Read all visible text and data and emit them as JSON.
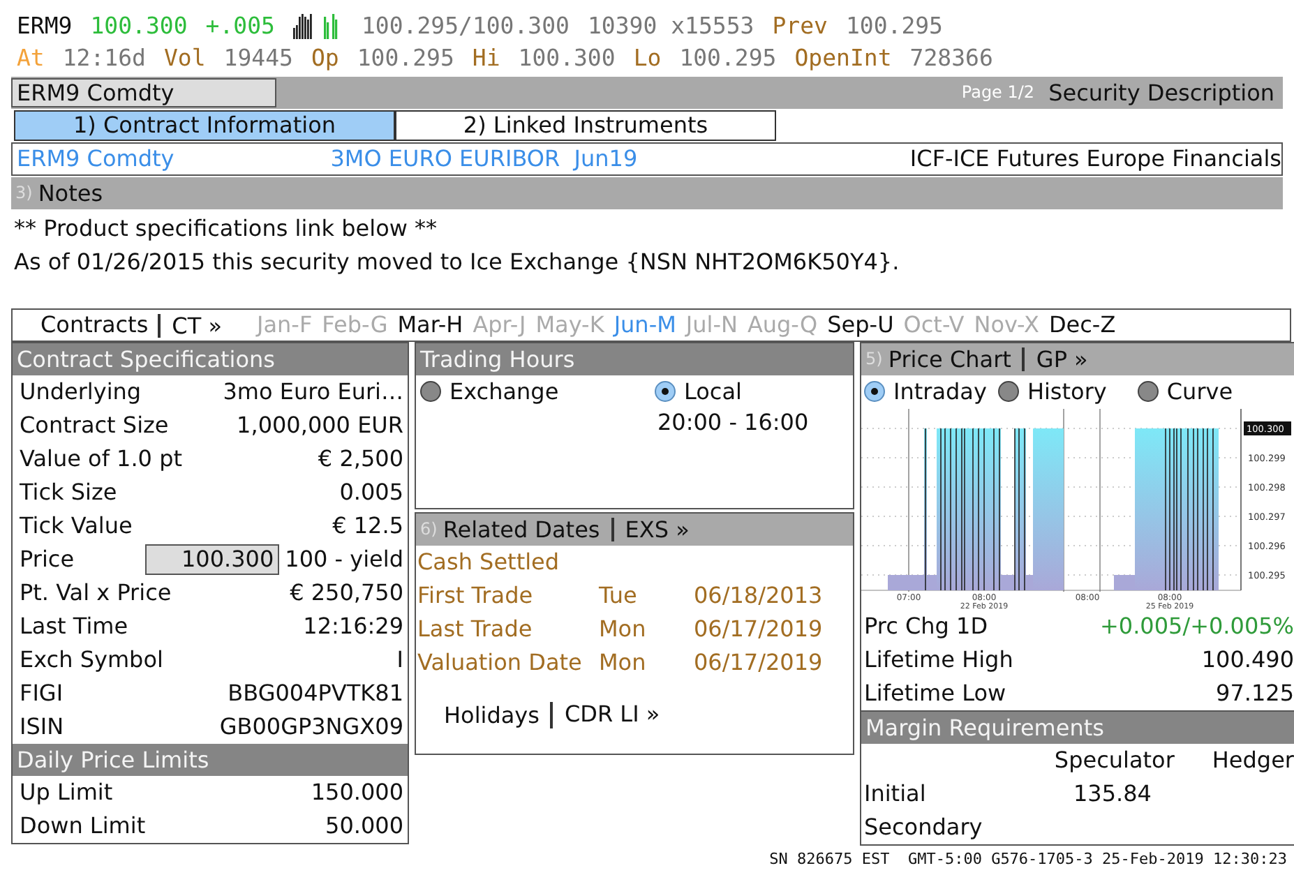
{
  "quote": {
    "lines": [
      [
        {
          "kind": "ticker",
          "text": "ERM9"
        },
        {
          "kind": "up",
          "text": "100.300"
        },
        {
          "kind": "up",
          "text": "+.005"
        },
        {
          "kind": "spark"
        },
        {
          "kind": "value",
          "text": "100.295/100.300"
        },
        {
          "kind": "value",
          "text": "10390 x15553"
        },
        {
          "kind": "label",
          "text": "Prev"
        },
        {
          "kind": "value",
          "text": "100.295"
        }
      ],
      [
        {
          "kind": "time",
          "text": "At"
        },
        {
          "kind": "value",
          "text": "12:16d"
        },
        {
          "kind": "label",
          "text": "Vol"
        },
        {
          "kind": "value",
          "text": "19445"
        },
        {
          "kind": "label",
          "text": "Op"
        },
        {
          "kind": "value",
          "text": "100.295"
        },
        {
          "kind": "label",
          "text": "Hi"
        },
        {
          "kind": "value",
          "text": "100.300"
        },
        {
          "kind": "label",
          "text": "Lo"
        },
        {
          "kind": "value",
          "text": "100.295"
        },
        {
          "kind": "label",
          "text": "OpenInt"
        },
        {
          "kind": "value",
          "text": "728366"
        }
      ]
    ]
  },
  "title_bar": {
    "security": "ERM9 Comdty",
    "page": "Page 1/2",
    "title": "Security Description"
  },
  "tabs": [
    {
      "label": "1) Contract Information",
      "selected": true
    },
    {
      "label": "2) Linked Instruments",
      "selected": false
    }
  ],
  "info_line": {
    "ticker": "ERM9 Comdty",
    "name": "3MO EURO EURIBOR  Jun19",
    "exchange": "ICF-ICE Futures Europe Financials"
  },
  "notes": {
    "number": "3)",
    "title": "Notes",
    "lines": [
      "** Product specifications link below **",
      "As of 01/26/2015 this security moved to Ice Exchange {NSN NHT2OM6K50Y4}."
    ]
  },
  "contracts": {
    "title": "Contracts",
    "link": "CT »",
    "months": [
      {
        "label": "Jan-F",
        "active": false,
        "selected": false
      },
      {
        "label": "Feb-G",
        "active": false,
        "selected": false
      },
      {
        "label": "Mar-H",
        "active": true,
        "selected": false
      },
      {
        "label": "Apr-J",
        "active": false,
        "selected": false
      },
      {
        "label": "May-K",
        "active": false,
        "selected": false
      },
      {
        "label": "Jun-M",
        "active": true,
        "selected": true
      },
      {
        "label": "Jul-N",
        "active": false,
        "selected": false
      },
      {
        "label": "Aug-Q",
        "active": false,
        "selected": false
      },
      {
        "label": "Sep-U",
        "active": true,
        "selected": false
      },
      {
        "label": "Oct-V",
        "active": false,
        "selected": false
      },
      {
        "label": "Nov-X",
        "active": false,
        "selected": false
      },
      {
        "label": "Dec-Z",
        "active": true,
        "selected": false
      }
    ]
  },
  "contract_specifications": {
    "title": "Contract Specifications",
    "rows": [
      {
        "kind": "text",
        "label": "Underlying",
        "value": "3mo Euro Euri…"
      },
      {
        "kind": "text",
        "label": "Contract Size",
        "value": "1,000,000 EUR"
      },
      {
        "kind": "text",
        "label": "Value of 1.0 pt",
        "value": "€ 2,500"
      },
      {
        "kind": "text",
        "label": "Tick Size",
        "value": "0.005"
      },
      {
        "kind": "text",
        "label": "Tick Value",
        "value": "€ 12.5"
      },
      {
        "kind": "field",
        "label": "Price",
        "value": "100.300",
        "note": "100 - yield"
      },
      {
        "kind": "text",
        "label": "Pt. Val x Price",
        "value": "€ 250,750"
      },
      {
        "kind": "text",
        "label": "Last Time",
        "value": "12:16:29"
      },
      {
        "kind": "text",
        "label": "Exch Symbol",
        "value": "I"
      },
      {
        "kind": "text",
        "label": "FIGI",
        "value": "BBG004PVTK81"
      },
      {
        "kind": "text",
        "label": "ISIN",
        "value": "GB00GP3NGX09"
      }
    ]
  },
  "daily_price_limits": {
    "title": "Daily Price Limits",
    "rows": [
      {
        "label": "Up Limit",
        "value": "150.000"
      },
      {
        "label": "Down Limit",
        "value": "50.000"
      }
    ]
  },
  "trading_hours": {
    "title": "Trading Hours",
    "options": [
      {
        "label": "Exchange",
        "selected": false
      },
      {
        "label": "Local",
        "selected": true
      }
    ],
    "hours": "20:00 - 16:00"
  },
  "related_dates": {
    "number": "6)",
    "title": "Related Dates",
    "link": "EXS »",
    "rows": [
      {
        "label": "Cash Settled"
      },
      {
        "label": "First Trade",
        "day": "Tue",
        "date": "06/18/2013"
      },
      {
        "label": "Last Trade",
        "day": "Mon",
        "date": "06/17/2019"
      },
      {
        "label": "Valuation Date",
        "day": "Mon",
        "date": "06/17/2019"
      }
    ],
    "footer_title": "Holidays",
    "footer_link": "CDR LI »"
  },
  "price_chart": {
    "number": "5)",
    "title": "Price Chart",
    "link": "GP »",
    "options": [
      {
        "label": "Intraday",
        "selected": true
      },
      {
        "label": "History",
        "selected": false
      },
      {
        "label": "Curve",
        "selected": false
      }
    ],
    "y_labels": [
      "100.300",
      "100.299",
      "100.298",
      "100.297",
      "100.296",
      "100.295"
    ],
    "x_labels": [
      "07:00",
      "08:00",
      "08:00",
      "08:00"
    ],
    "date_labels": [
      "22 Feb 2019",
      "25 Feb 2019"
    ]
  },
  "stats": [
    {
      "kind": "up",
      "label": "Prc Chg 1D",
      "value": "+0.005/+0.005%"
    },
    {
      "kind": "plain",
      "label": "Lifetime High",
      "value": "100.490"
    },
    {
      "kind": "plain",
      "label": "Lifetime Low",
      "value": "97.125"
    }
  ],
  "margin_requirements": {
    "title": "Margin Requirements",
    "columns": [
      "Speculator",
      "Hedger"
    ],
    "rows": [
      {
        "label": "Initial",
        "speculator": "135.84"
      },
      {
        "label": "Secondary"
      }
    ]
  },
  "status_bar": "SN 826675 EST  GMT-5:00 G576-1705-3 25-Feb-2019 12:30:23"
}
